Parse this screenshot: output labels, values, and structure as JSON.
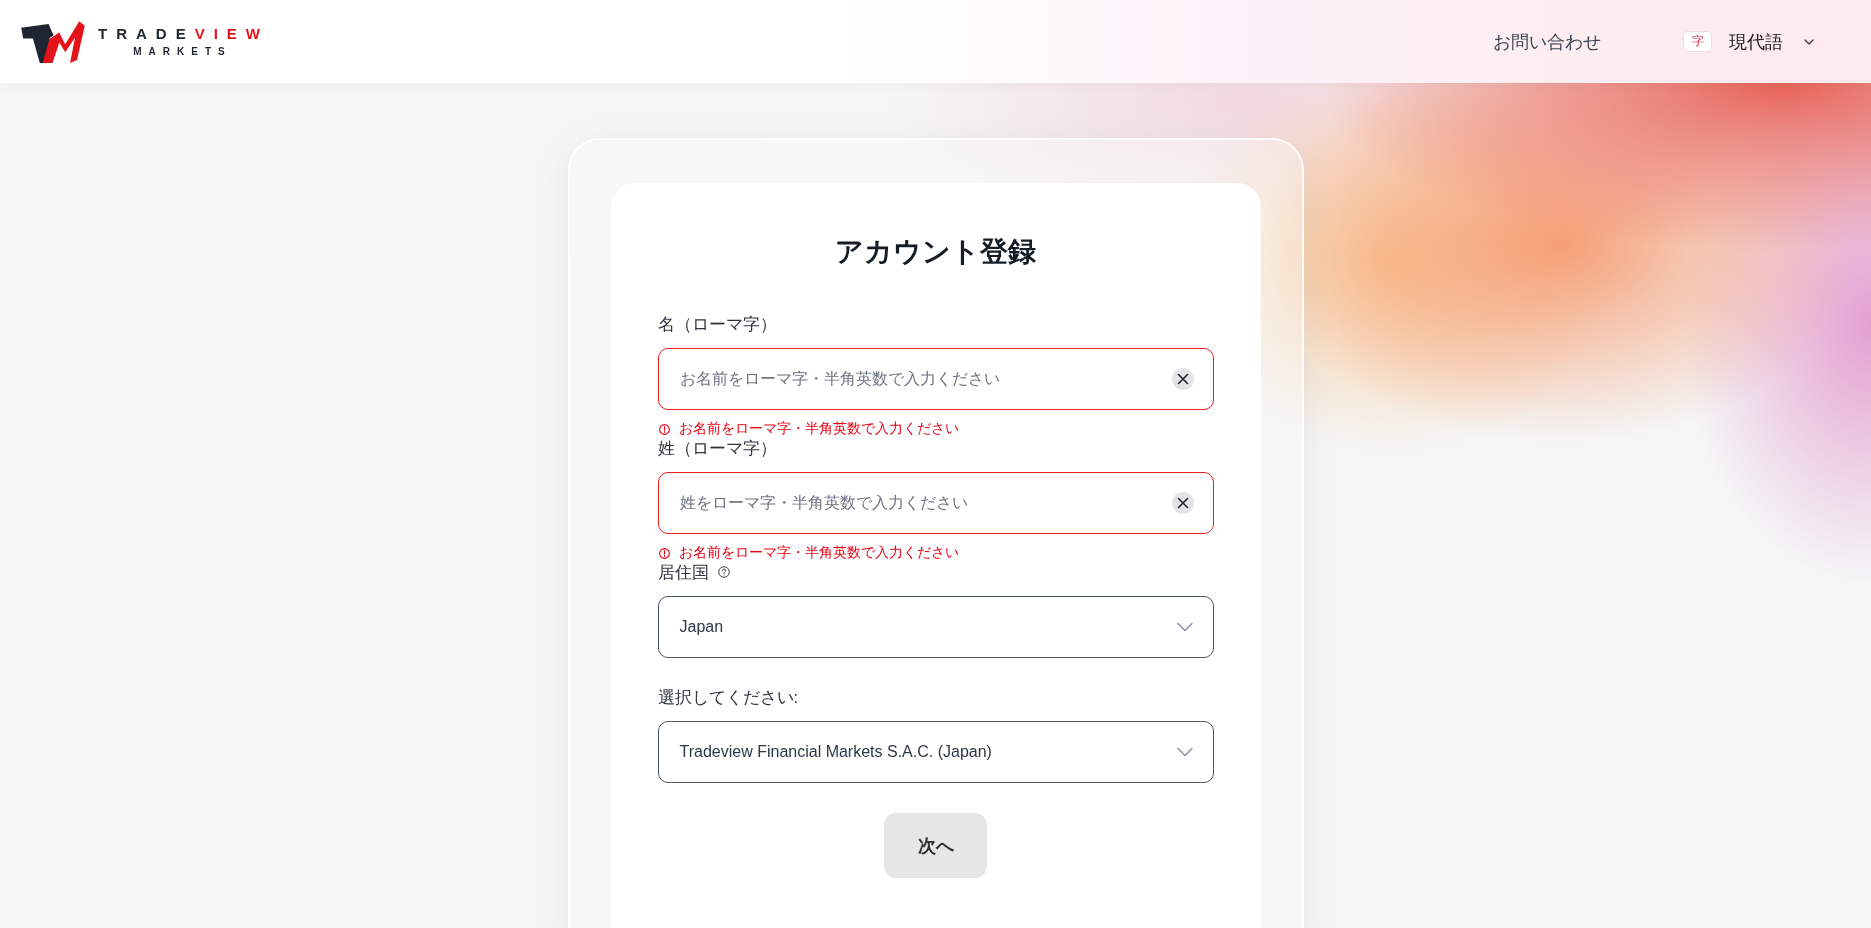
{
  "header": {
    "logo": {
      "wordmark_dark": "TRADE",
      "wordmark_accent": "VIEW",
      "tagline": "MARKETS"
    },
    "contact_link": "お問い合わせ",
    "language": {
      "badge": "字",
      "label": "現代語"
    }
  },
  "form": {
    "title": "アカウント登録",
    "fields": [
      {
        "kind": "text",
        "label": "名（ローマ字）",
        "help": false,
        "placeholder": "お名前をローマ字・半角英数で入力ください",
        "invalid": true,
        "error": "お名前をローマ字・半角英数で入力ください"
      },
      {
        "kind": "text",
        "label": "姓（ローマ字）",
        "help": false,
        "placeholder": "姓をローマ字・半角英数で入力ください",
        "invalid": true,
        "error": "お名前をローマ字・半角英数で入力ください"
      },
      {
        "kind": "select",
        "label": "居住国",
        "help": true,
        "value": "Japan",
        "invalid": false
      },
      {
        "kind": "select",
        "label": "選択してください:",
        "help": false,
        "value": "Tradeview Financial Markets S.A.C. (Japan)",
        "invalid": false
      }
    ],
    "button": {
      "label": "次へ",
      "disabled": true
    }
  }
}
